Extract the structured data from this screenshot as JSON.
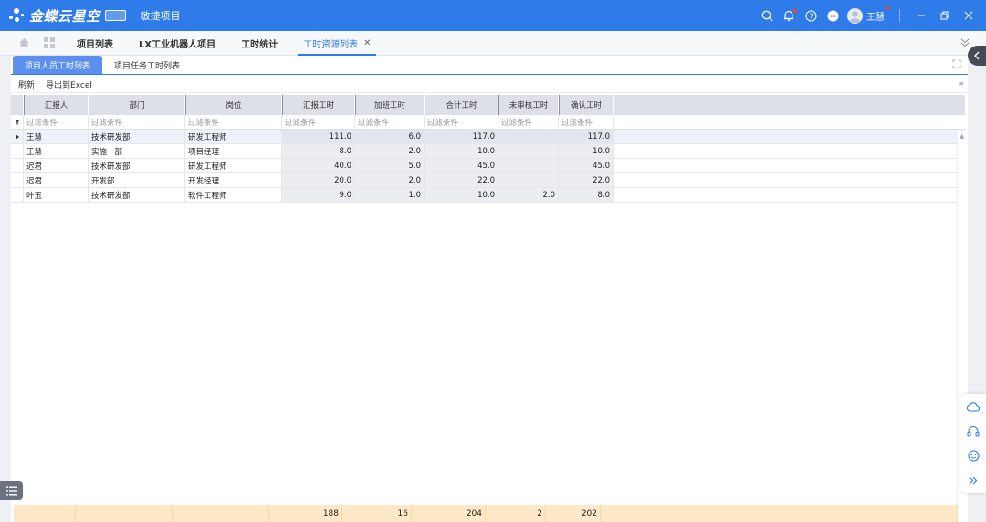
{
  "app": {
    "logo_text": "金蝶云星空",
    "edition_badge": "",
    "name": "敏捷项目"
  },
  "user": {
    "name": "王慧"
  },
  "page_tabs": [
    {
      "label": "项目列表"
    },
    {
      "label": "LX工业机器人项目"
    },
    {
      "label": "工时统计"
    },
    {
      "label": "工时资源列表"
    }
  ],
  "sub_tabs": [
    {
      "label": "项目人员工时列表"
    },
    {
      "label": "项目任务工时列表"
    }
  ],
  "toolbar": {
    "refresh": "刷新",
    "export": "导出到Excel"
  },
  "grid": {
    "columns": [
      "汇报人",
      "部门",
      "岗位",
      "汇报工时",
      "加班工时",
      "合计工时",
      "未审核工时",
      "确认工时"
    ],
    "filter_placeholder": "过滤条件",
    "rows": [
      {
        "reporter": "王慧",
        "dept": "技术研发部",
        "post": "研发工程师",
        "reported": "111.0",
        "overtime": "6.0",
        "total": "117.0",
        "unreviewed": "",
        "confirmed": "117.0"
      },
      {
        "reporter": "王慧",
        "dept": "实施一部",
        "post": "项目经理",
        "reported": "8.0",
        "overtime": "2.0",
        "total": "10.0",
        "unreviewed": "",
        "confirmed": "10.0"
      },
      {
        "reporter": "迟君",
        "dept": "技术研发部",
        "post": "研发工程师",
        "reported": "40.0",
        "overtime": "5.0",
        "total": "45.0",
        "unreviewed": "",
        "confirmed": "45.0"
      },
      {
        "reporter": "迟君",
        "dept": "开发部",
        "post": "开发经理",
        "reported": "20.0",
        "overtime": "2.0",
        "total": "22.0",
        "unreviewed": "",
        "confirmed": "22.0"
      },
      {
        "reporter": "叶玉",
        "dept": "技术研发部",
        "post": "软件工程师",
        "reported": "9.0",
        "overtime": "1.0",
        "total": "10.0",
        "unreviewed": "2.0",
        "confirmed": "8.0"
      }
    ],
    "totals": {
      "reported": "188",
      "overtime": "16",
      "total": "204",
      "unreviewed": "2",
      "confirmed": "202"
    }
  },
  "colors": {
    "brand": "#2f7bea",
    "header_bg": "#dde1e7",
    "footer_bg": "#fde9c7",
    "notification_dot": "#ff3b30"
  },
  "icons": [
    "search-icon",
    "bell-icon",
    "help-icon",
    "minus-circle-icon",
    "avatar",
    "minimize-icon",
    "restore-icon",
    "close-icon",
    "home-icon",
    "apps-grid-icon",
    "collapse-icon",
    "expand-icon",
    "cloud-icon",
    "headset-icon",
    "smile-icon",
    "double-chevron-icon",
    "list-icon"
  ]
}
